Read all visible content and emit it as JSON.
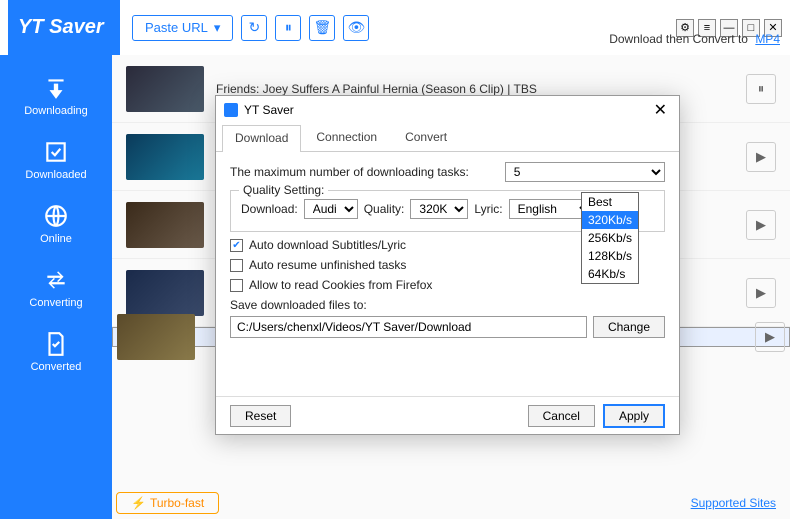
{
  "app_name": "YT Saver",
  "paste_label": "Paste URL",
  "convert_prefix": "Download then Convert to",
  "convert_format": "MP4",
  "nav": [
    "Downloading",
    "Downloaded",
    "Online",
    "Converting",
    "Converted"
  ],
  "video_title": "Friends: Joey Suffers A Painful Hernia (Season 6 Clip) | TBS",
  "turbo": "Turbo-fast",
  "supported": "Supported Sites",
  "dlg": {
    "title": "YT Saver",
    "tabs": [
      "Download",
      "Connection",
      "Convert"
    ],
    "active_tab": 0,
    "max_tasks_label": "The maximum number of downloading tasks:",
    "max_tasks_value": "5",
    "quality_legend": "Quality Setting:",
    "download_label": "Download:",
    "download_value": "Audio",
    "quality_label": "Quality:",
    "quality_value": "320Kb/s",
    "lyric_label": "Lyric:",
    "lyric_value": "English",
    "quality_options": [
      "Best",
      "320Kb/s",
      "256Kb/s",
      "128Kb/s",
      "64Kb/s"
    ],
    "quality_selected_index": 1,
    "chk1": {
      "checked": true,
      "label": "Auto download Subtitles/Lyric"
    },
    "chk2": {
      "checked": false,
      "label": "Auto resume unfinished tasks"
    },
    "chk3": {
      "checked": false,
      "label": "Allow to read Cookies from Firefox"
    },
    "save_label": "Save downloaded files to:",
    "save_path": "C:/Users/chenxl/Videos/YT Saver/Download",
    "change": "Change",
    "reset": "Reset",
    "cancel": "Cancel",
    "apply": "Apply"
  }
}
